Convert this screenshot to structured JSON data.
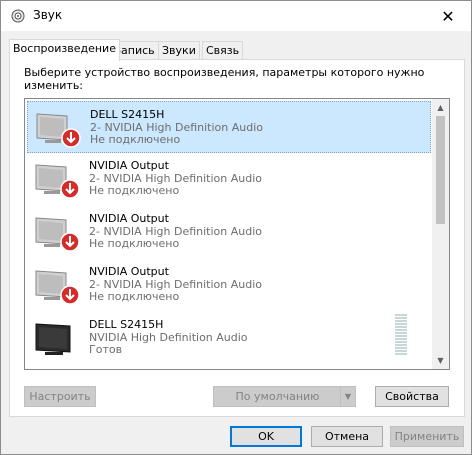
{
  "window": {
    "title": "Звук",
    "close_glyph": "✕"
  },
  "tabs": [
    {
      "label": "Воспроизведение",
      "active": true
    },
    {
      "label": "Запись",
      "active": false
    },
    {
      "label": "Звуки",
      "active": false
    },
    {
      "label": "Связь",
      "active": false
    }
  ],
  "panel": {
    "description": "Выберите устройство воспроизведения, параметры которого нужно изменить:"
  },
  "devices": [
    {
      "name": "DELL S2415H",
      "driver": "2- NVIDIA High Definition Audio",
      "status": "Не подключено",
      "disconnected": true,
      "selected": true
    },
    {
      "name": "NVIDIA Output",
      "driver": "2- NVIDIA High Definition Audio",
      "status": "Не подключено",
      "disconnected": true,
      "selected": false
    },
    {
      "name": "NVIDIA Output",
      "driver": "2- NVIDIA High Definition Audio",
      "status": "Не подключено",
      "disconnected": true,
      "selected": false
    },
    {
      "name": "NVIDIA Output",
      "driver": "2- NVIDIA High Definition Audio",
      "status": "Не подключено",
      "disconnected": true,
      "selected": false
    },
    {
      "name": "DELL S2415H",
      "driver": "NVIDIA High Definition Audio",
      "status": "Готов",
      "disconnected": false,
      "selected": false
    }
  ],
  "buttons": {
    "configure": "Настроить",
    "set_default": "По умолчанию",
    "properties": "Свойства",
    "ok": "OK",
    "cancel": "Отмена",
    "apply": "Применить"
  },
  "colors": {
    "selection": "#cce8ff",
    "accent": "#0078d7",
    "disconnected_badge": "#d42b2b"
  }
}
